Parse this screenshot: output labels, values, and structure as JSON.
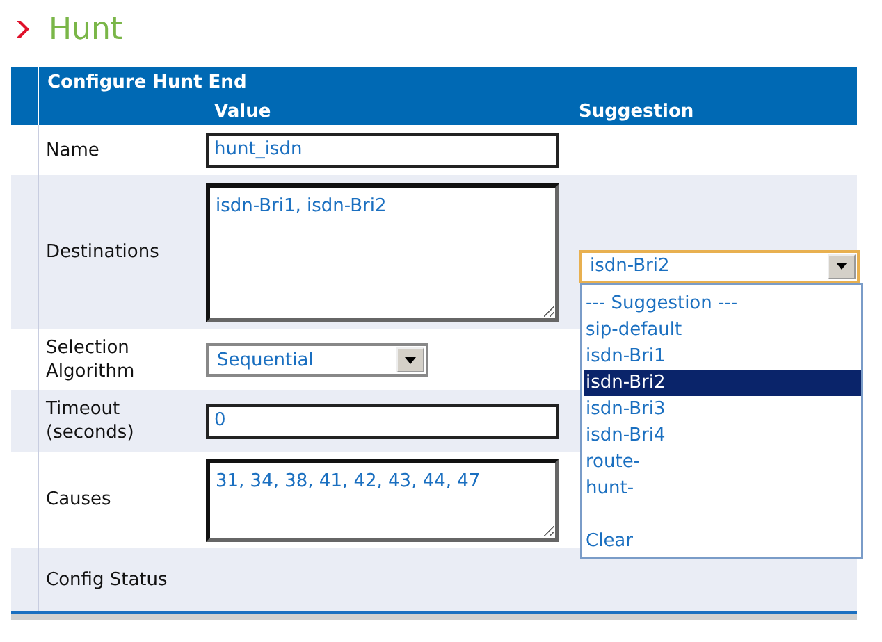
{
  "page_title": "Hunt",
  "panel": {
    "title": "Configure Hunt End",
    "columns": [
      "Value",
      "Suggestion"
    ]
  },
  "rows": [
    {
      "kind": "input",
      "label": "Name",
      "value": "hunt_isdn"
    },
    {
      "kind": "textarea",
      "label": "Destinations",
      "value": "isdn-Bri1, isdn-Bri2",
      "suggestion": {
        "value": "isdn-Bri2",
        "open": true,
        "options": [
          {
            "kind": "option",
            "text": "--- Suggestion ---",
            "selected": false
          },
          {
            "kind": "option",
            "text": "sip-default",
            "selected": false
          },
          {
            "kind": "option",
            "text": "isdn-Bri1",
            "selected": false
          },
          {
            "kind": "option",
            "text": "isdn-Bri2",
            "selected": true
          },
          {
            "kind": "option",
            "text": "isdn-Bri3",
            "selected": false
          },
          {
            "kind": "option",
            "text": "isdn-Bri4",
            "selected": false
          },
          {
            "kind": "option",
            "text": "route-",
            "selected": false
          },
          {
            "kind": "option",
            "text": "hunt-",
            "selected": false
          },
          {
            "kind": "blank"
          },
          {
            "kind": "option",
            "text": "Clear",
            "selected": false
          }
        ]
      }
    },
    {
      "kind": "select",
      "label": "Selection Algorithm",
      "value": "Sequential"
    },
    {
      "kind": "input",
      "label": "Timeout (seconds)",
      "value": "0"
    },
    {
      "kind": "textarea",
      "label": "Causes",
      "value": "31, 34, 38, 41, 42, 43, 44, 47"
    },
    {
      "kind": "status",
      "label": "Config Status"
    }
  ]
}
